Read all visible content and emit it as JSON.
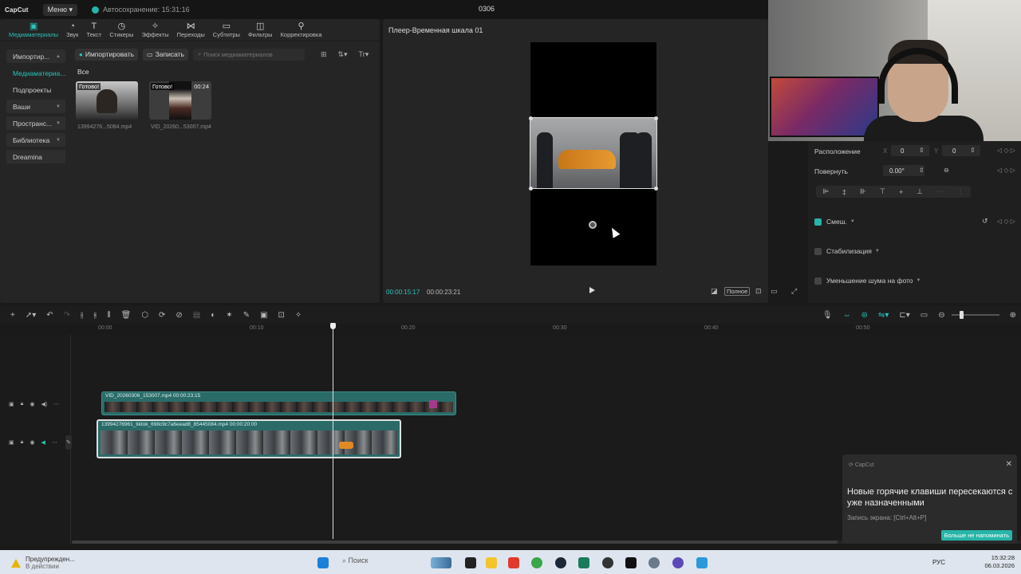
{
  "titlebar": {
    "logo": "CapCut",
    "menu": "Меню",
    "autosave": "Автосохранение: 15:31:16",
    "project": "0306"
  },
  "toolbar": {
    "tabs": [
      {
        "label": "Медиаматериалы",
        "icon": "media-icon"
      },
      {
        "label": "Звук",
        "icon": "audio-icon"
      },
      {
        "label": "Текст",
        "icon": "text-icon"
      },
      {
        "label": "Стикеры",
        "icon": "sticker-icon"
      },
      {
        "label": "Эффекты",
        "icon": "effects-icon"
      },
      {
        "label": "Переходы",
        "icon": "transitions-icon"
      },
      {
        "label": "Субтитры",
        "icon": "subtitles-icon"
      },
      {
        "label": "Фильтры",
        "icon": "filters-icon"
      },
      {
        "label": "Корректировка",
        "icon": "adjust-icon"
      }
    ]
  },
  "sidenav": {
    "items": [
      "Импортир...",
      "Медиаматериа...",
      "Подпроекты",
      "Ваши",
      "Пространс...",
      "Библиотека",
      "Dreamina"
    ]
  },
  "media": {
    "import_label": "Импортировать",
    "record_label": "Записать",
    "search_placeholder": "Поиск медиаматериалов",
    "all_label": "Все",
    "clips": [
      {
        "badge": "Готово!",
        "name": "13994276...5084.mp4",
        "duration": ""
      },
      {
        "badge": "Готово!",
        "name": "VID_20260...53007.mp4",
        "duration": "00:24"
      }
    ]
  },
  "player": {
    "title": "Плеер-Временная шкала 01",
    "current_time": "00:00:15:17",
    "total_time": "00:00:23:21",
    "full_label": "Полное"
  },
  "props": {
    "position_label": "Расположение",
    "x_label": "X",
    "x_value": "0",
    "y_label": "Y",
    "y_value": "0",
    "rotate_label": "Повернуть",
    "rotate_value": "0.00°",
    "blend_label": "Смеш.",
    "stabilize_label": "Стабилизация",
    "denoise_label": "Уменьшение шума на фото"
  },
  "timeline": {
    "ticks": [
      "00:00",
      "00:10",
      "00:20",
      "00:30",
      "00:40",
      "00:50"
    ],
    "track_a_label": "VID_20260306_153007.mp4   00:00:23:15",
    "track_b_label": "13994276961_tiktok_698c9c7a6eead8_85445084.mp4   00:00:20:00"
  },
  "toast": {
    "app": "CapCut",
    "title": "Новые горячие клавиши пересекаются с уже назначенными",
    "subtitle": "Запись экрана: [Ctrl+Alt+P]",
    "button": "Больше не напоминать"
  },
  "taskbar": {
    "warn_title": "Предупрежден...",
    "warn_sub": "В действии",
    "search": "Поиск",
    "lang": "РУС",
    "time": "15:32:28",
    "date": "06.03.2026"
  },
  "colors": {
    "accent": "#28c4b8",
    "panel": "#252526",
    "track": "#2a6b68"
  }
}
